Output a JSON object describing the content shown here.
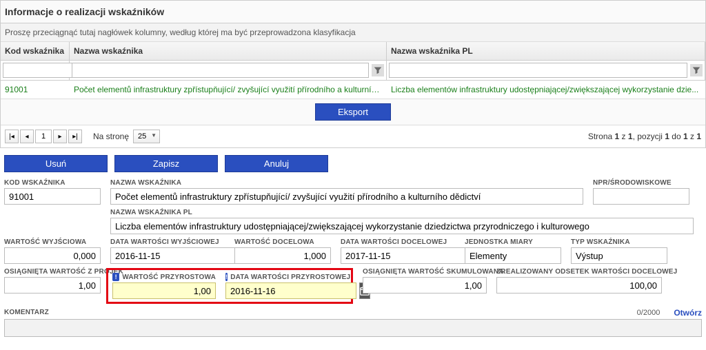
{
  "panel": {
    "title": "Informacje o realizacji wskaźników",
    "drag_hint": "Proszę przeciągnąć tutaj nagłówek kolumny, według której ma być przeprowadzona klasyfikacja"
  },
  "grid": {
    "headers": {
      "kod": "Kod wskaźnika",
      "nazwa": "Nazwa wskaźnika",
      "nazwa_pl": "Nazwa wskaźnika PL"
    },
    "row": {
      "kod": "91001",
      "nazwa": "Počet elementů infrastruktury zpřístupňující/ zvyšující využití přírodního a kulturníh...",
      "nazwa_pl": "Liczba elementów infrastruktury udostępniającej/zwiększającej wykorzystanie dzie..."
    }
  },
  "export_label": "Eksport",
  "pager": {
    "page": "1",
    "per_page_label": "Na stronę",
    "per_page": "25",
    "status_prefix": "Strona ",
    "status_mid1": "1",
    "status_z1": " z ",
    "status_mid2": "1",
    "status_poz": ", pozycji ",
    "status_mid3": "1",
    "status_do": " do ",
    "status_mid4": "1",
    "status_z2": " z ",
    "status_mid5": "1"
  },
  "actions": {
    "delete": "Usuń",
    "save": "Zapisz",
    "cancel": "Anuluj"
  },
  "form": {
    "kod_label": "KOD WSKAŹNIKA",
    "kod": "91001",
    "nazwa_label": "NAZWA WSKAŹNIKA",
    "nazwa": "Počet elementů infrastruktury zpřístupňující/ zvyšující využití přírodního a kulturního dědictví",
    "npr_label": "NPR/ŚRODOWISKOWE",
    "npr": "",
    "nazwa_pl_label": "NAZWA WSKAŹNIKA PL",
    "nazwa_pl": "Liczba elementów infrastruktury udostępniającej/zwiększającej wykorzystanie dziedzictwa przyrodniczego i kulturowego",
    "wart_wyj_label": "WARTOŚĆ WYJŚCIOWA",
    "wart_wyj": "0,000",
    "data_wyj_label": "DATA WARTOŚCI WYJŚCIOWEJ",
    "data_wyj": "2016-11-15",
    "wart_doc_label": "WARTOŚĆ DOCELOWA",
    "wart_doc": "1,000",
    "data_doc_label": "DATA WARTOŚCI DOCELOWEJ",
    "data_doc": "2017-11-15",
    "jedn_label": "JEDNOSTKA MIARY",
    "jedn": "Elementy",
    "typ_label": "TYP WSKAŹNIKA",
    "typ": "Výstup",
    "osiag_proj_label": "OSIĄGNIĘTA WARTOŚĆ Z PROJEK",
    "osiag_proj": "1,00",
    "wart_przyr_label": "WARTOŚĆ PRZYROSTOWA",
    "wart_przyr": "1,00",
    "data_przyr_label": "DATA WARTOŚCI PRZYROSTOWEJ",
    "data_przyr": "2016-11-16",
    "osiag_skum_label": "OSIĄGNIĘTA WARTOŚĆ SKUMULOWANA",
    "osiag_skum": "1,00",
    "zreal_label": "ZREALIZOWANY ODSETEK WARTOŚCI DOCELOWEJ",
    "zreal": "100,00",
    "komentarz_label": "KOMENTARZ",
    "komentarz_count": "0/2000",
    "open": "Otwórz"
  }
}
